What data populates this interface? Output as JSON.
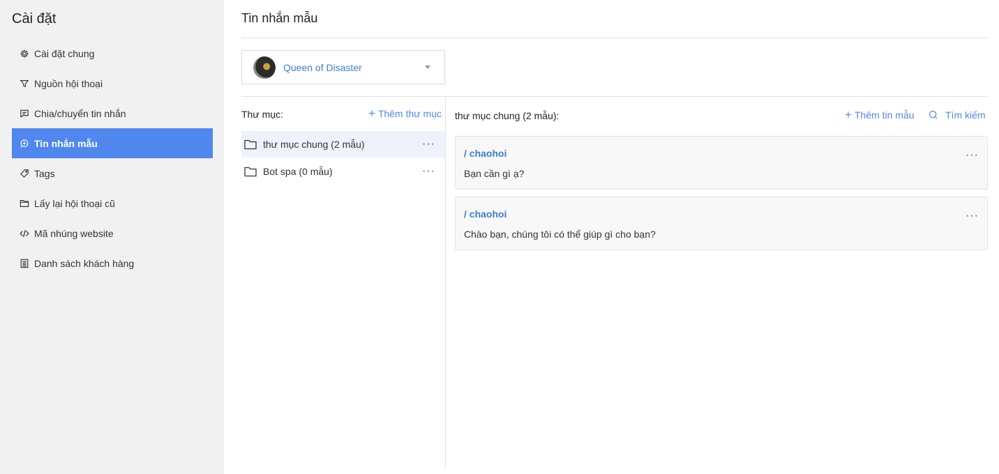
{
  "sidebar": {
    "title": "Cài đặt",
    "items": [
      {
        "label": "Cài đặt chung",
        "icon": "gear-icon",
        "active": false
      },
      {
        "label": "Nguồn hội thoại",
        "icon": "filter-icon",
        "active": false
      },
      {
        "label": "Chia/chuyển tin nhắn",
        "icon": "message-icon",
        "active": false
      },
      {
        "label": "Tin nhắn mẫu",
        "icon": "template-message-icon",
        "active": true
      },
      {
        "label": "Tags",
        "icon": "tag-icon",
        "active": false
      },
      {
        "label": "Lấy lại hội thoại cũ",
        "icon": "folder-icon",
        "active": false
      },
      {
        "label": "Mã nhúng website",
        "icon": "code-icon",
        "active": false
      },
      {
        "label": "Danh sách khách hàng",
        "icon": "list-icon",
        "active": false
      }
    ]
  },
  "main": {
    "title": "Tin nhắn mẫu",
    "page_select": {
      "value": "Queen of Disaster"
    },
    "folders": {
      "label": "Thư mục:",
      "add_label": "Thêm thư mục",
      "items": [
        {
          "name": "thư mục chung (2 mẫu)",
          "active": true
        },
        {
          "name": "Bot spa (0 mẫu)",
          "active": false
        }
      ]
    },
    "templates": {
      "header": "thư mục chung (2 mẫu):",
      "add_label": "Thêm tin mẫu",
      "search_label": "Tìm kiếm",
      "items": [
        {
          "shortcut": "/ chaohoi",
          "text": "Bạn cần gì ạ?"
        },
        {
          "shortcut": "/ chaohoi",
          "text": "Chào bạn, chúng tôi có thể giúp gì cho bạn?"
        }
      ]
    }
  },
  "colors": {
    "accent": "#4f87ef",
    "link": "#3d7fcc",
    "sidebar_bg": "#f1f1f1"
  }
}
